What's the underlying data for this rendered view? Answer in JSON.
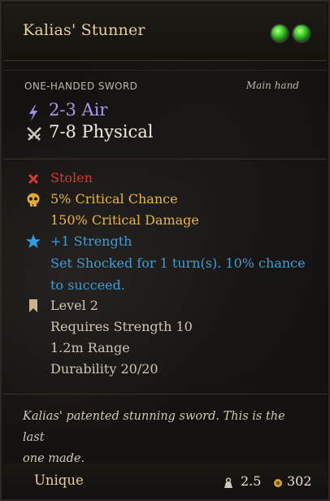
{
  "tooltip": {
    "title": "Kalias' Stunner",
    "item_type": "ONE-HANDED SWORD",
    "slot": "Main hand",
    "damage": [
      {
        "text": "2-3 Air",
        "icon": "lightning-icon",
        "color": "#a79bf0"
      },
      {
        "text": "7-8 Physical",
        "icon": "crossed-swords-icon",
        "color": "#f1ece0"
      }
    ],
    "properties": {
      "stolen": "Stolen",
      "crit_chance": "5% Critical Chance",
      "crit_damage": "150% Critical Damage",
      "strength_bonus": "+1 Strength",
      "effect_line1": "Set Shocked for 1 turn(s). 10% chance",
      "effect_line2": "to succeed.",
      "level": "Level 2",
      "requirement": "Requires Strength 10",
      "range": "1.2m Range",
      "durability": "Durability 20/20"
    },
    "description_line1": "Kalias' patented stunning sword. This is the last",
    "description_line2": "one made.",
    "rarity": "Unique",
    "weight": "2.5",
    "value": "302",
    "rune_slots": 2,
    "colors": {
      "title": "#e6cf98",
      "stolen": "#d43a30",
      "critical": "#e8b63e",
      "bonus": "#3b9fd6",
      "rune": "#3fcf2b"
    }
  }
}
